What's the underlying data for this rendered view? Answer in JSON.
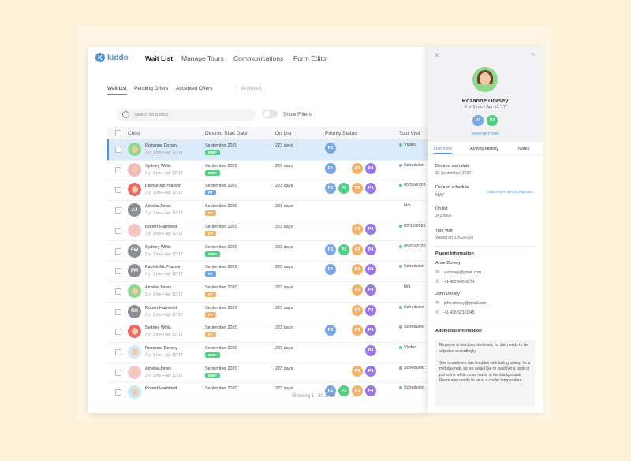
{
  "app": {
    "logo": "kiddo",
    "logo_mark": "K"
  },
  "nav": [
    "Wait List",
    "Manage Tours",
    "Communications",
    "Form Editor"
  ],
  "subtabs": [
    "Wait List",
    "Pending Offers",
    "Accepted Offers",
    "Archived"
  ],
  "search": {
    "placeholder": "Search for a child"
  },
  "filters": {
    "label": "Show Filters"
  },
  "columns": [
    "Child",
    "Desired Start Date",
    "On List",
    "Priority Status",
    "Tour Visit"
  ],
  "rows": [
    {
      "name": "Rozanne Dorsey",
      "age": "3 yr 1 mo • Apr 12 '17",
      "start": "September 2020",
      "sched": "MWF",
      "on_list": "223 days",
      "priority": [
        "P1"
      ],
      "tour": "Visited",
      "avatar": "photo",
      "initials": ""
    },
    {
      "name": "Sydney Willis",
      "age": "3 yr 1 mo • Apr 12 '17",
      "start": "September 2020",
      "sched": "MWF",
      "on_list": "223 days",
      "priority": [
        "P1",
        "P3",
        "P4"
      ],
      "tour": "Scheduled",
      "avatar": "photo",
      "initials": ""
    },
    {
      "name": "Patrick McPharson",
      "age": "3 yr 1 mo • Apr 12 '17",
      "start": "September 2020",
      "sched": "PT",
      "on_list": "223 days",
      "priority": [
        "P1",
        "P2",
        "P3",
        "P4"
      ],
      "tour": "05/06/2020",
      "avatar": "photo",
      "initials": ""
    },
    {
      "name": "Amelia Jones",
      "age": "3 yr 1 mo • Apr 12 '17",
      "start": "September 2020",
      "sched": "FT",
      "on_list": "223 days",
      "priority": [],
      "tour": "N/a",
      "avatar": "initials",
      "initials": "AJ"
    },
    {
      "name": "Robert Hammett",
      "age": "3 yr 1 mo • Apr 12 '17",
      "start": "September 2020",
      "sched": "FT",
      "on_list": "223 days",
      "priority": [
        "P3",
        "P4"
      ],
      "tour": "03/12/2020",
      "avatar": "photo",
      "initials": ""
    },
    {
      "name": "Sydney Willis",
      "age": "3 yr 1 mo • Apr 12 '17",
      "start": "September 2020",
      "sched": "MWF",
      "on_list": "223 days",
      "priority": [
        "P1",
        "P2",
        "P3",
        "P4"
      ],
      "tour": "05/06/2020",
      "avatar": "initials",
      "initials": "SW"
    },
    {
      "name": "Patrick McPharson",
      "age": "3 yr 1 mo • Apr 12 '17",
      "start": "September 2020",
      "sched": "PT",
      "on_list": "223 days",
      "priority": [
        "P1",
        "P3",
        "P4"
      ],
      "tour": "Scheduled",
      "avatar": "initials",
      "initials": "PM"
    },
    {
      "name": "Amelia Jones",
      "age": "3 yr 1 mo • Apr 12 '17",
      "start": "September 2020",
      "sched": "FT",
      "on_list": "223 days",
      "priority": [
        "P3",
        "P4"
      ],
      "tour": "N/a",
      "avatar": "photo",
      "initials": ""
    },
    {
      "name": "Robert Hammett",
      "age": "3 yr 1 mo • Apr 12 '17",
      "start": "September 2020",
      "sched": "FT",
      "on_list": "223 days",
      "priority": [
        "P3",
        "P4"
      ],
      "tour": "Scheduled",
      "avatar": "initials",
      "initials": "RH"
    },
    {
      "name": "Sydney Willis",
      "age": "3 yr 1 mo • Apr 12 '17",
      "start": "September 2020",
      "sched": "FT",
      "on_list": "223 days",
      "priority": [
        "P1",
        "P3",
        "P4"
      ],
      "tour": "Scheduled",
      "avatar": "photo",
      "initials": ""
    },
    {
      "name": "Rozanne Dorsey",
      "age": "3 yr 1 mo • Apr 12 '17",
      "start": "September 2020",
      "sched": "MWF",
      "on_list": "223 days",
      "priority": [
        "P4"
      ],
      "tour": "Visited",
      "avatar": "photo",
      "initials": ""
    },
    {
      "name": "Amelia Jones",
      "age": "3 yr 1 mo • Apr 12 '17",
      "start": "September 2020",
      "sched": "MWF",
      "on_list": "223 days",
      "priority": [
        "P3",
        "P4"
      ],
      "tour": "Scheduled",
      "avatar": "photo",
      "initials": ""
    },
    {
      "name": "Robert Hammett",
      "age": "",
      "start": "September 2020",
      "sched": "",
      "on_list": "223 days",
      "priority": [
        "P1",
        "P2",
        "P3",
        "P4"
      ],
      "tour": "Scheduled",
      "avatar": "photo",
      "initials": ""
    }
  ],
  "pager": {
    "text": "Showing 1 - 50 of 53",
    "prev": "‹ ‹",
    "next": "› ›"
  },
  "panel": {
    "name": "Rozanne Dorsey",
    "age": "3 yr 1 mo • Apr 12 '17",
    "priority": [
      "P1",
      "P2"
    ],
    "view_profile": "View Full Profile",
    "tabs": [
      "Overview",
      "Activity History",
      "Notes"
    ],
    "desired_start_label": "Desired start date",
    "desired_start_value": "31 September, 2020",
    "desired_schedule_label": "Desired schedule",
    "desired_schedule_value": "MWF",
    "add_schedule": "ADD ANOTHER SCHEDULE",
    "on_list_label": "On list",
    "on_list_value": "342 days",
    "tour_label": "Tour visit",
    "tour_value": "Visited on 02/02/2020",
    "parent_header": "Parent Information",
    "parents": [
      {
        "name": "Anne Dorsey",
        "email": "a.dorsey@gmail.com",
        "phone": "+1-402-545-9274"
      },
      {
        "name": "John Dorsey",
        "email": "john.dorsey@gmail.com",
        "phone": "+1-436-521-0345"
      }
    ],
    "additional_header": "Additional Information",
    "additional_text": "Rozanne is loactose intolerant, no diet needs to be adjusted accordingly.\n\nShe sometimes has troubles with falling asleep for a mid-day nap, so we usuall  like to read her a book or put some white noise music in the background. Room also needs to be at a cooler temperature."
  },
  "colors": {
    "accent": "#4a90e2",
    "P1": "#7aa8e6",
    "P2": "#4fcf84",
    "P3": "#f2b26b",
    "P4": "#9a79e3",
    "MWF": "#56cf86",
    "PT": "#6ea8ea",
    "FT": "#f0b36a",
    "Visited": "#4fcf84",
    "Scheduled": "#7aa8e6",
    "Date": "#4fcf84"
  }
}
